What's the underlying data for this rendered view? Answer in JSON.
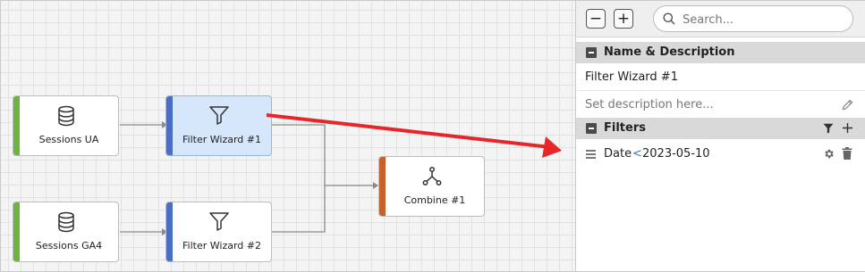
{
  "canvas": {
    "nodes": [
      {
        "id": "sessions-ua",
        "label": "Sessions UA",
        "icon": "database-icon",
        "accent": "#6db33f"
      },
      {
        "id": "filter-1",
        "label": "Filter Wizard #1",
        "icon": "filter-icon",
        "accent": "#4a6ec4",
        "selected": true
      },
      {
        "id": "sessions-ga4",
        "label": "Sessions GA4",
        "icon": "database-icon",
        "accent": "#6db33f"
      },
      {
        "id": "filter-2",
        "label": "Filter Wizard #2",
        "icon": "filter-icon",
        "accent": "#4a6ec4"
      },
      {
        "id": "combine-1",
        "label": "Combine #1",
        "icon": "merge-icon",
        "accent": "#c8602a"
      }
    ]
  },
  "toolbar": {
    "zoom_out_label": "−",
    "zoom_in_label": "+",
    "search_placeholder": "Search..."
  },
  "name_section": {
    "title": "Name & Description",
    "name_value": "Filter Wizard #1",
    "description_placeholder": "Set description here...",
    "edit_icon": "pencil-icon"
  },
  "filters_section": {
    "title": "Filters",
    "filter_icon": "funnel-icon",
    "add_icon": "plus-icon",
    "items": [
      {
        "field": "Date",
        "operator": "<",
        "value": "2023-05-10",
        "settings_icon": "gear-icon",
        "delete_icon": "trash-icon"
      }
    ]
  },
  "annotation": {
    "color": "#e8262a"
  }
}
